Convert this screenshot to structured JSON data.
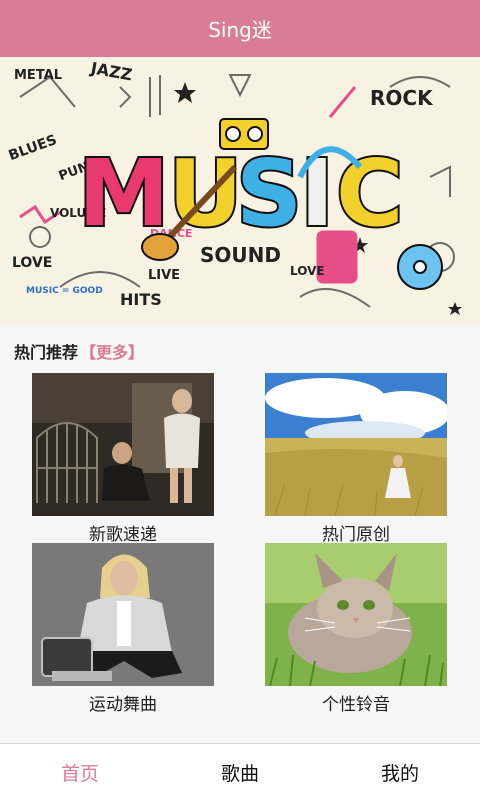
{
  "app": {
    "title": "Sing迷"
  },
  "banner": {
    "word": "MUSIC",
    "doodle_words": [
      "METAL",
      "JAZZ",
      "ROCK",
      "BLUES",
      "PUNK",
      "VOLUME",
      "DANCE",
      "SOUND",
      "LOVE",
      "LIVE",
      "HITS",
      "MUSIC = GOOD",
      "LOVE"
    ]
  },
  "section": {
    "title": "热门推荐",
    "more": "【更多】"
  },
  "cards": [
    {
      "label": "新歌速递",
      "image": "couple-with-birdcage-photo"
    },
    {
      "label": "热门原创",
      "image": "girl-in-meadow-photo"
    },
    {
      "label": "运动舞曲",
      "image": "woman-sitting-on-drum-photo"
    },
    {
      "label": "个性铃音",
      "image": "kitten-in-grass-photo"
    }
  ],
  "tabs": [
    {
      "label": "首页",
      "active": true
    },
    {
      "label": "歌曲",
      "active": false
    },
    {
      "label": "我的",
      "active": false
    }
  ],
  "colors": {
    "accent": "#d97c96",
    "background": "#f6f6f6"
  }
}
